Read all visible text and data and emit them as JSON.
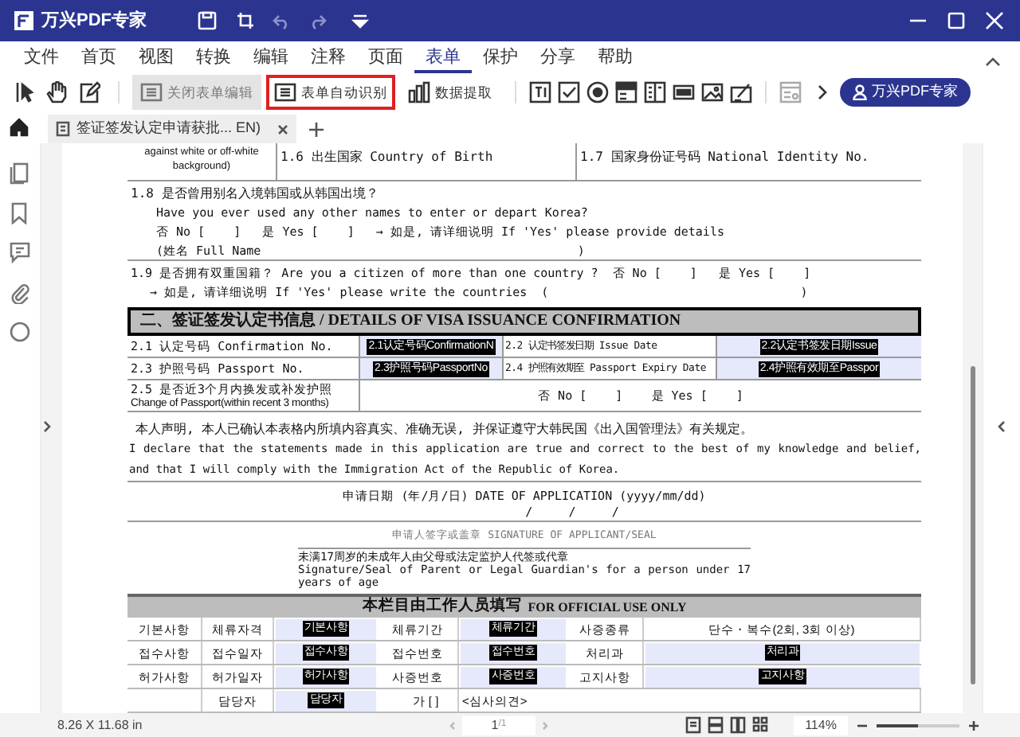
{
  "app": {
    "title": "万兴PDF专家"
  },
  "menu": [
    {
      "label": "文件",
      "selected": false
    },
    {
      "label": "首页",
      "selected": false
    },
    {
      "label": "视图",
      "selected": false
    },
    {
      "label": "转换",
      "selected": false
    },
    {
      "label": "编辑",
      "selected": false
    },
    {
      "label": "注释",
      "selected": false
    },
    {
      "label": "页面",
      "selected": false
    },
    {
      "label": "表单",
      "selected": true
    },
    {
      "label": "保护",
      "selected": false
    },
    {
      "label": "分享",
      "selected": false
    },
    {
      "label": "帮助",
      "selected": false
    }
  ],
  "toolbar": {
    "buttons": [
      {
        "label": "关闭表单编辑",
        "selected": true,
        "highlighted": false
      },
      {
        "label": "表单自动识别",
        "selected": false,
        "highlighted": true
      },
      {
        "label": "数据提取",
        "selected": false,
        "highlighted": false
      }
    ],
    "account_button": "万兴PDF专家"
  },
  "tab": {
    "title": "签证签发认定申请获批... EN)"
  },
  "document": {
    "top_row": [
      "against white or off-white background)",
      "1.6 出生国家 Country of Birth",
      "1.7 国家身份证号码 National Identity No."
    ],
    "question_1_8": [
      "1.8 是否曾用别名入境韩国或从韩国出境？",
      "Have you ever used any other names to enter or depart Korea?",
      "否 No [    ]   是 Yes [    ]   → 如是, 请详细说明 If 'Yes' please provide details",
      "(姓名 Full Name                                            )"
    ],
    "question_1_9": [
      "1.9 是否拥有双重国籍？ Are you a citizen of more than one country ?  否 No [    ]   是 Yes [    ]",
      "→ 如是, 请详细说明 If 'Yes' please write the countries  (                                   )"
    ],
    "section_title": "二、签证签发认定书信息 / DETAILS OF VISA ISSUANCE CONFIRMATION",
    "visa_rows": [
      {
        "label": "2.1 认定号码 Confirmation No.",
        "field": "2.1认定号码ConfirmationN",
        "label_2": "2.2 认定书签发日期 Issue Date",
        "field_2": "2.2认定书签发日期Issue"
      },
      {
        "label": "2.3 护照号码 Passport No.",
        "field": "2.3护照号码PassportNo",
        "label_2": "2.4 护照有效期至 Passport Expiry Date",
        "field_2": "2.4护照有效期至Passpor"
      }
    ],
    "passport_change": {
      "label": [
        "2.5 是否近3个月内换发或补发护照",
        "Change of Passport(within recent 3 months)"
      ],
      "answer": "否 No [    ]    是 Yes [    ]"
    },
    "declaration": [
      "本人声明, 本人已确认本表格内所填内容真实、准确无误, 并保证遵守大韩民国《出入国管理法》有关规定。",
      "I declare that the statements made in this application are true and correct to the best of my knowledge and belief, and that I will comply with the Immigration Act of the Republic of Korea."
    ],
    "date_label": "申请日期 (年/月/日) DATE OF APPLICATION (yyyy/mm/dd)",
    "date_slashes": "/     /     /",
    "signature_label": "申请人签字或盖章 SIGNATURE OF APPLICANT/SEAL",
    "guardian": [
      "未满17周岁的未成年人由父母或法定监护人代签或代章",
      "Signature/Seal of Parent or Legal Guardian's for a person under 17 years of age"
    ],
    "official_title": {
      "zh": "本栏目由工作人员填写",
      "en": "FOR OFFICIAL USE ONLY"
    },
    "official_rows": [
      [
        {
          "kind": "label",
          "text": "기본사항"
        },
        {
          "kind": "label",
          "text": "체류자격"
        },
        {
          "kind": "field",
          "text": "기본사항"
        },
        {
          "kind": "label",
          "text": "체류기간"
        },
        {
          "kind": "field",
          "text": "체류기간"
        },
        {
          "kind": "label",
          "text": "사증종류"
        },
        {
          "kind": "label",
          "text": "단수・복수(2회, 3회 이상)"
        }
      ],
      [
        {
          "kind": "label",
          "text": "접수사항"
        },
        {
          "kind": "label",
          "text": "접수일자"
        },
        {
          "kind": "field",
          "text": "접수사항"
        },
        {
          "kind": "label",
          "text": "접수번호"
        },
        {
          "kind": "field",
          "text": "접수번호"
        },
        {
          "kind": "label",
          "text": "처리과"
        },
        {
          "kind": "field",
          "text": "처리과"
        }
      ],
      [
        {
          "kind": "label",
          "text": "허가사항"
        },
        {
          "kind": "label",
          "text": "허가일자"
        },
        {
          "kind": "field",
          "text": "허가사항"
        },
        {
          "kind": "label",
          "text": "사증번호"
        },
        {
          "kind": "field",
          "text": "사증번호"
        },
        {
          "kind": "label",
          "text": "고지사항"
        },
        {
          "kind": "field",
          "text": "고지사항"
        }
      ],
      [
        {
          "kind": "empty",
          "text": ""
        },
        {
          "kind": "label",
          "text": "담당자"
        },
        {
          "kind": "field",
          "text": "담당자"
        },
        {
          "kind": "label",
          "text": "가 [    ]"
        },
        {
          "kind": "label",
          "text": "<심사의견>"
        }
      ]
    ]
  },
  "status_bar": {
    "page_size": "8.26 X 11.68 in",
    "page": "1",
    "page_total": "/1",
    "zoom": "114%",
    "zoom_slider": {
      "level": 0.5
    }
  }
}
